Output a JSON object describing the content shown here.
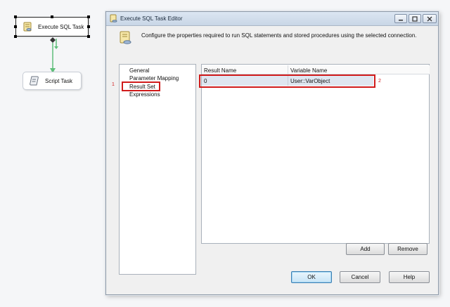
{
  "canvas": {
    "tasks": [
      {
        "label": "Execute SQL Task",
        "icon": "sql-task-icon"
      },
      {
        "label": "Script Task",
        "icon": "script-task-icon"
      }
    ]
  },
  "dialog": {
    "title": "Execute SQL Task Editor",
    "description": "Configure the properties required to run SQL statements and stored procedures using the selected connection.",
    "nav": [
      "General",
      "Parameter Mapping",
      "Result Set",
      "Expressions"
    ],
    "grid": {
      "columns": [
        "Result Name",
        "Variable Name"
      ],
      "rows": [
        {
          "result_name": "0",
          "variable_name": "User::VarObject"
        }
      ]
    },
    "buttons": {
      "add": "Add",
      "remove": "Remove",
      "ok": "OK",
      "cancel": "Cancel",
      "help": "Help"
    }
  },
  "annotations": {
    "label1": "1",
    "label2": "2"
  },
  "colors": {
    "annotation": "#d01b1b",
    "selected_row": "#dfe6f0",
    "precedence_arrow": "#5fbf7a"
  }
}
